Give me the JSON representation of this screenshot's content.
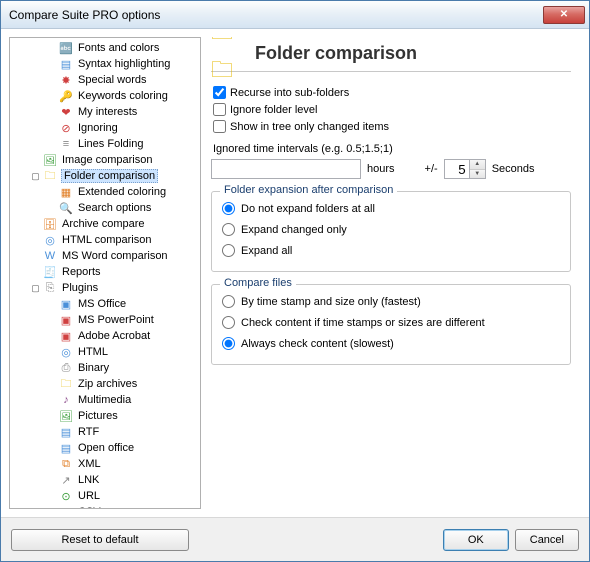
{
  "window": {
    "title": "Compare Suite PRO options"
  },
  "tree": [
    {
      "depth": 2,
      "icon": "🔤",
      "iconCls": "ic-page",
      "label": "Fonts and colors"
    },
    {
      "depth": 2,
      "icon": "▤",
      "iconCls": "ic-page",
      "label": "Syntax highlighting"
    },
    {
      "depth": 2,
      "icon": "✸",
      "iconCls": "ic-red",
      "label": "Special words"
    },
    {
      "depth": 2,
      "icon": "🔑",
      "iconCls": "ic-orange",
      "label": "Keywords coloring"
    },
    {
      "depth": 2,
      "icon": "❤",
      "iconCls": "ic-red",
      "label": "My interests"
    },
    {
      "depth": 2,
      "icon": "⊘",
      "iconCls": "ic-red",
      "label": "Ignoring"
    },
    {
      "depth": 2,
      "icon": "≡",
      "iconCls": "ic-gray",
      "label": "Lines Folding"
    },
    {
      "depth": 1,
      "icon": "🖼",
      "iconCls": "ic-green",
      "label": "Image comparison"
    },
    {
      "depth": 1,
      "toggle": "▣",
      "icon": "🗀",
      "iconCls": "ic-folder",
      "label": "Folder comparison",
      "selected": true
    },
    {
      "depth": 2,
      "icon": "▦",
      "iconCls": "ic-orange",
      "label": "Extended coloring"
    },
    {
      "depth": 2,
      "icon": "🔍",
      "iconCls": "ic-gray",
      "label": "Search options"
    },
    {
      "depth": 1,
      "icon": "🗄",
      "iconCls": "ic-orange",
      "label": "Archive compare"
    },
    {
      "depth": 1,
      "icon": "◎",
      "iconCls": "ic-page",
      "label": "HTML comparison"
    },
    {
      "depth": 1,
      "icon": "W",
      "iconCls": "ic-page",
      "label": "MS Word comparison"
    },
    {
      "depth": 1,
      "icon": "🧾",
      "iconCls": "ic-gray",
      "label": "Reports"
    },
    {
      "depth": 1,
      "toggle": "▣",
      "icon": "⎘",
      "iconCls": "ic-gray",
      "label": "Plugins"
    },
    {
      "depth": 2,
      "icon": "▣",
      "iconCls": "ic-page",
      "label": "MS Office"
    },
    {
      "depth": 2,
      "icon": "▣",
      "iconCls": "ic-red",
      "label": "MS PowerPoint"
    },
    {
      "depth": 2,
      "icon": "▣",
      "iconCls": "ic-red",
      "label": "Adobe Acrobat"
    },
    {
      "depth": 2,
      "icon": "◎",
      "iconCls": "ic-page",
      "label": "HTML"
    },
    {
      "depth": 2,
      "icon": "⎙",
      "iconCls": "ic-gray",
      "label": "Binary"
    },
    {
      "depth": 2,
      "icon": "🗀",
      "iconCls": "ic-folder",
      "label": "Zip archives"
    },
    {
      "depth": 2,
      "icon": "♪",
      "iconCls": "ic-purple",
      "label": "Multimedia"
    },
    {
      "depth": 2,
      "icon": "🖼",
      "iconCls": "ic-green",
      "label": "Pictures"
    },
    {
      "depth": 2,
      "icon": "▤",
      "iconCls": "ic-page",
      "label": "RTF"
    },
    {
      "depth": 2,
      "icon": "▤",
      "iconCls": "ic-page",
      "label": "Open office"
    },
    {
      "depth": 2,
      "icon": "⧉",
      "iconCls": "ic-orange",
      "label": "XML"
    },
    {
      "depth": 2,
      "icon": "↗",
      "iconCls": "ic-gray",
      "label": "LNK"
    },
    {
      "depth": 2,
      "icon": "⊙",
      "iconCls": "ic-green",
      "label": "URL"
    },
    {
      "depth": 2,
      "icon": "▥",
      "iconCls": "ic-green",
      "label": "CSV"
    }
  ],
  "panel": {
    "title": "Folder comparison",
    "check_recurse": "Recurse into sub-folders",
    "check_ignore_level": "Ignore folder level",
    "check_show_changed": "Show in tree only changed items",
    "interval_label": "Ignored time intervals (e.g. 0.5;1.5;1)",
    "hours_label": "hours",
    "plusminus": "+/-",
    "seconds_value": "5",
    "seconds_label": "Seconds",
    "group_expansion": {
      "title": "Folder expansion after comparison",
      "r1": "Do not expand folders at all",
      "r2": "Expand changed only",
      "r3": "Expand all"
    },
    "group_compare": {
      "title": "Compare files",
      "r1": "By time stamp and size only (fastest)",
      "r2": "Check content if time stamps or sizes are different",
      "r3": "Always check content (slowest)"
    }
  },
  "footer": {
    "reset": "Reset to default",
    "ok": "OK",
    "cancel": "Cancel"
  }
}
